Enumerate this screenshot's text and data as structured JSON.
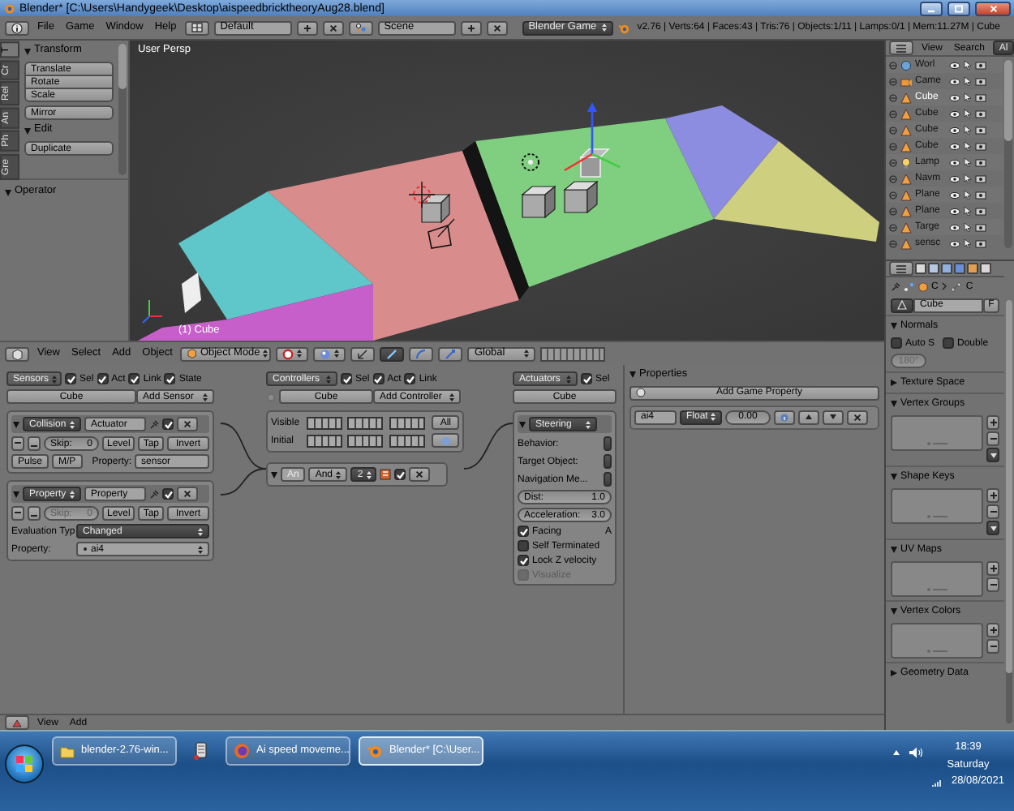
{
  "window": {
    "title": "Blender* [C:\\Users\\Handygeek\\Desktop\\aispeedbricktheoryAug28.blend]"
  },
  "menu_bar": {
    "menus": [
      "File",
      "Game",
      "Window",
      "Help"
    ],
    "layout": "Default",
    "scene": "Scene",
    "engine": "Blender Game",
    "stats": "v2.76 | Verts:64 | Faces:43 | Tris:76 | Objects:1/11 | Lamps:0/1 | Mem:11.27M | Cube"
  },
  "tool_shelf": {
    "tabs": [
      {
        "label": "T",
        "selected": true
      },
      {
        "label": "Cr",
        "selected": false
      },
      {
        "label": "Rel",
        "selected": false
      },
      {
        "label": "An",
        "selected": false
      },
      {
        "label": "Ph",
        "selected": false
      },
      {
        "label": "Gre",
        "selected": false
      }
    ],
    "panels": [
      {
        "title": "Transform",
        "expanded": true,
        "groups": [
          [
            "Translate",
            "Rotate",
            "Scale"
          ],
          [
            "Mirror"
          ]
        ]
      },
      {
        "title": "Edit",
        "expanded": true,
        "groups": [
          [
            "Duplicate"
          ]
        ]
      }
    ],
    "operator": {
      "title": "Operator",
      "expanded": true
    }
  },
  "viewport": {
    "view_label": "User Persp",
    "object_label": "(1) Cube"
  },
  "view3d_header": {
    "menus": [
      "View",
      "Select",
      "Add",
      "Object"
    ],
    "mode": "Object Mode",
    "orientation": "Global"
  },
  "logic": {
    "sensors": {
      "title": "Sensors",
      "filters": [
        {
          "label": "Sel",
          "checked": true
        },
        {
          "label": "Act",
          "checked": true
        },
        {
          "label": "Link",
          "checked": true
        },
        {
          "label": "State",
          "checked": true
        }
      ],
      "object": "Cube",
      "add": "Add Sensor",
      "bricks": [
        {
          "kind": "collision",
          "expanded": true,
          "active": true,
          "type": "Collision",
          "name": "Actuator",
          "skip_label": "Skip:",
          "skip": "0",
          "skip_disabled": false,
          "buttons": [
            "Level",
            "Tap",
            "Invert"
          ],
          "pulse": "Pulse",
          "mp": "M/P",
          "property_label": "Property:",
          "property": "sensor"
        },
        {
          "kind": "property",
          "expanded": true,
          "active": true,
          "type": "Property",
          "name": "Property",
          "skip_label": "Skip:",
          "skip": "0",
          "skip_disabled": true,
          "buttons": [
            "Level",
            "Tap",
            "Invert"
          ],
          "evaluation_label": "Evaluation Typ",
          "evaluation": "Changed",
          "property_label": "Property:",
          "property": "ai4"
        }
      ]
    },
    "controllers": {
      "title": "Controllers",
      "filters": [
        {
          "label": "Sel",
          "checked": true
        },
        {
          "label": "Act",
          "checked": true
        },
        {
          "label": "Link",
          "checked": true
        }
      ],
      "object": "Cube",
      "add": "Add Controller",
      "visible_label": "Visible",
      "initial_label": "Initial",
      "all": "All",
      "bricks": [
        {
          "expanded": true,
          "active": true,
          "name": "An",
          "type": "And",
          "priority": "2"
        }
      ]
    },
    "actuators": {
      "title": "Actuators",
      "filters": [
        {
          "label": "Sel",
          "checked": true
        }
      ],
      "object": "Cube",
      "bricks": [
        {
          "expanded": true,
          "type": "Steering",
          "fields": [
            "Behavior:",
            "Target Object:",
            "Navigation Me..."
          ],
          "sliders": [
            {
              "label": "Dist:",
              "value": "1.0"
            },
            {
              "label": "Acceleration:",
              "value": "3.0"
            }
          ],
          "facing_axis": "A",
          "options": [
            {
              "label": "Facing",
              "checked": true,
              "disabled": false
            },
            {
              "label": "Self Terminated",
              "checked": false,
              "disabled": false
            },
            {
              "label": "Lock Z velocity",
              "checked": true,
              "disabled": false
            },
            {
              "label": "Visualize",
              "checked": false,
              "disabled": true
            }
          ]
        }
      ]
    },
    "properties": {
      "title": "Properties",
      "expanded": true,
      "add": "Add Game Property",
      "items": [
        {
          "name": "ai4",
          "type": "Float",
          "value": "0.00"
        }
      ]
    }
  },
  "logic_header": {
    "menus": [
      "View",
      "Add"
    ]
  },
  "outliner": {
    "menus": [
      "View",
      "Search"
    ],
    "filter": "Al",
    "items": [
      {
        "kind": "world",
        "name": "Worl",
        "selected": false
      },
      {
        "kind": "camera",
        "name": "Came",
        "selected": false
      },
      {
        "kind": "mesh",
        "name": "Cube",
        "selected": true
      },
      {
        "kind": "mesh",
        "name": "Cube",
        "selected": false
      },
      {
        "kind": "mesh",
        "name": "Cube",
        "selected": false
      },
      {
        "kind": "mesh",
        "name": "Cube",
        "selected": false
      },
      {
        "kind": "lamp",
        "name": "Lamp",
        "selected": false
      },
      {
        "kind": "mesh",
        "name": "Navm",
        "selected": false
      },
      {
        "kind": "mesh",
        "name": "Plane",
        "selected": false
      },
      {
        "kind": "mesh",
        "name": "Plane",
        "selected": false
      },
      {
        "kind": "mesh",
        "name": "Targe",
        "selected": false
      },
      {
        "kind": "mesh",
        "name": "sensc",
        "selected": false
      }
    ]
  },
  "properties_editor": {
    "breadcrumbs": [
      "C",
      "C"
    ],
    "name": "Cube",
    "fake_user": "F",
    "panels": [
      {
        "kind": "normals",
        "title": "Normals",
        "expanded": true,
        "options": [
          {
            "label": "Auto S",
            "checked": false
          },
          {
            "label": "Double",
            "checked": false
          }
        ],
        "angle": "180°"
      },
      {
        "kind": "plain",
        "title": "Texture Space",
        "expanded": false
      },
      {
        "kind": "list",
        "title": "Vertex Groups",
        "expanded": true,
        "menu_button": true
      },
      {
        "kind": "list",
        "title": "Shape Keys",
        "expanded": true,
        "menu_button": true
      },
      {
        "kind": "list",
        "title": "UV Maps",
        "expanded": true,
        "menu_button": false
      },
      {
        "kind": "list",
        "title": "Vertex Colors",
        "expanded": true,
        "menu_button": false
      },
      {
        "kind": "plain",
        "title": "Geometry Data",
        "expanded": false
      }
    ]
  },
  "taskbar": {
    "items": [
      {
        "kind": "folder",
        "label": "blender-2.76-win...",
        "selected": false
      },
      {
        "kind": "app",
        "selected": false
      },
      {
        "kind": "browser",
        "label": "Ai speed moveme...",
        "selected": false
      },
      {
        "kind": "blender",
        "label": "Blender* [C:\\User...",
        "selected": true
      }
    ],
    "time": "18:39",
    "day": "Saturday",
    "date": "28/08/2021"
  }
}
